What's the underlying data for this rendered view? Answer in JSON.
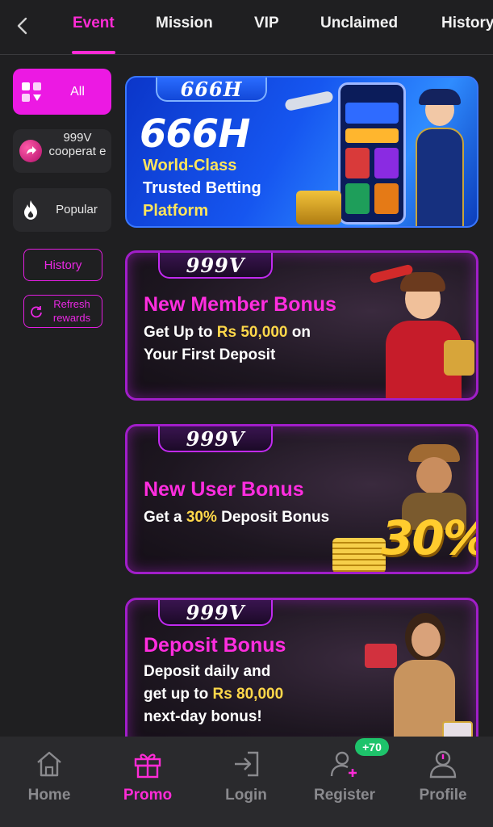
{
  "tabs": [
    "Event",
    "Mission",
    "VIP",
    "Unclaimed",
    "History"
  ],
  "active_tab": "Event",
  "sidebar": {
    "all_label": "All",
    "items": [
      {
        "label": "999V cooperat e",
        "icon": "arrow-badge-icon"
      },
      {
        "label": "Popular",
        "icon": "flame-icon"
      }
    ],
    "history_label": "History",
    "refresh_label": "Refresh rewards"
  },
  "banners": [
    {
      "brand": "666H",
      "title": "666H",
      "lines": [
        "World-Class",
        "Trusted Betting",
        "Platform"
      ]
    },
    {
      "brand": "999V",
      "title": "New Member Bonus",
      "line1_a": "Get Up to ",
      "line1_hl": "Rs 50,000",
      "line1_b": " on",
      "line2": "Your First Deposit"
    },
    {
      "brand": "999V",
      "title": "New User Bonus",
      "line1_a": "Get a ",
      "line1_hl": "30%",
      "line1_b": " Deposit Bonus",
      "badge": "30%"
    },
    {
      "brand": "999V",
      "title": "Deposit Bonus",
      "line1": "Deposit daily and",
      "line2_a": "get up to ",
      "line2_hl": "Rs 80,000",
      "line3": "next-day bonus!"
    }
  ],
  "bottom_nav": [
    {
      "label": "Home",
      "icon": "home-icon"
    },
    {
      "label": "Promo",
      "icon": "gift-icon"
    },
    {
      "label": "Login",
      "icon": "login-icon"
    },
    {
      "label": "Register",
      "icon": "add-user-icon"
    },
    {
      "label": "Profile",
      "icon": "profile-icon"
    }
  ],
  "register_badge": "+70",
  "colors": {
    "accent": "#ff2bd6",
    "background": "#1f1f21",
    "highlight": "#ffd84a",
    "badge": "#1ec36b"
  }
}
